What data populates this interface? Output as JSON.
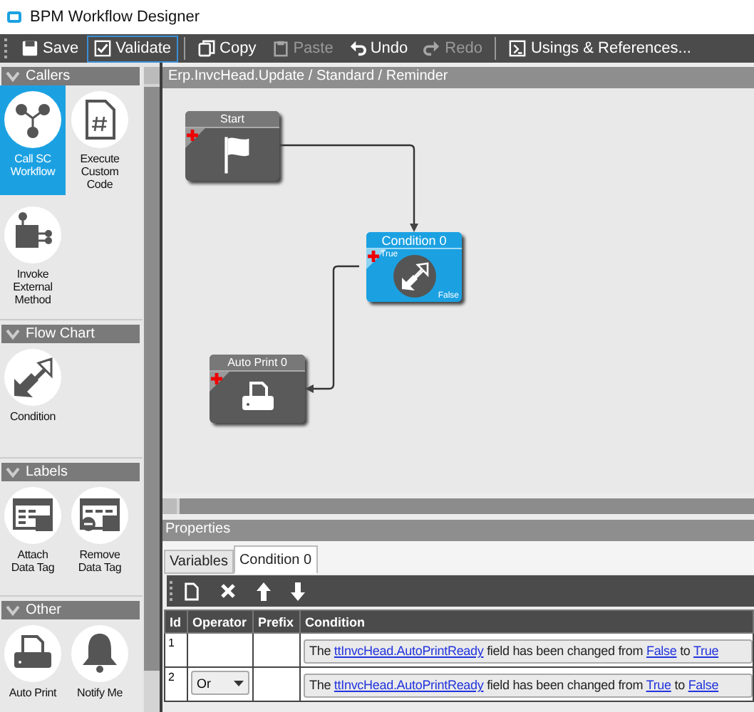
{
  "window": {
    "title": "BPM Workflow Designer"
  },
  "toolbar_groups": [
    [
      {
        "label": "Save",
        "kind": "save",
        "disabled": false,
        "focused": false
      },
      {
        "label": "Validate",
        "kind": "validate",
        "disabled": false,
        "focused": true
      }
    ],
    [
      {
        "label": "Copy",
        "kind": "copy",
        "disabled": false,
        "focused": false
      },
      {
        "label": "Paste",
        "kind": "paste",
        "disabled": true,
        "focused": false
      },
      {
        "label": "Undo",
        "kind": "undo",
        "disabled": false,
        "focused": false
      },
      {
        "label": "Redo",
        "kind": "redo",
        "disabled": true,
        "focused": false
      }
    ],
    [
      {
        "label": "Usings & References...",
        "kind": "usings",
        "disabled": false,
        "focused": false
      }
    ]
  ],
  "palette": {
    "sections": [
      {
        "title": "Callers",
        "expanded": true,
        "items": [
          {
            "label": "Call SC Workflow",
            "kind": "workflow",
            "selected": true
          },
          {
            "label": "Execute Custom Code",
            "kind": "code",
            "selected": false
          },
          {
            "label": "Invoke External Method",
            "kind": "method",
            "selected": false
          }
        ]
      },
      {
        "title": "Flow Chart",
        "expanded": true,
        "items": [
          {
            "label": "Condition",
            "kind": "condition",
            "selected": false
          }
        ]
      },
      {
        "title": "Labels",
        "expanded": true,
        "items": [
          {
            "label": "Attach Data Tag",
            "kind": "attach",
            "selected": false
          },
          {
            "label": "Remove Data Tag",
            "kind": "remove",
            "selected": false
          }
        ]
      },
      {
        "title": "Other",
        "expanded": true,
        "items": [
          {
            "label": "Auto Print",
            "kind": "print",
            "selected": false
          },
          {
            "label": "Notify Me",
            "kind": "bell",
            "selected": false
          }
        ]
      }
    ]
  },
  "canvas": {
    "path": "Erp.InvcHead.Update / Standard / Reminder",
    "nodes": [
      {
        "title": "Start",
        "kind": "start",
        "selected": false
      },
      {
        "title": "Condition 0",
        "kind": "condition",
        "selected": true,
        "true_label": "True",
        "false_label": "False"
      },
      {
        "title": "Auto Print 0",
        "kind": "print",
        "selected": false
      }
    ]
  },
  "properties": {
    "title": "Properties",
    "tabs": [
      {
        "label": "Variables",
        "selected": false
      },
      {
        "label": "Condition 0",
        "selected": true
      }
    ],
    "table": {
      "columns": [
        "Id",
        "Operator",
        "Prefix",
        "Condition"
      ],
      "rows": [
        {
          "id": "1",
          "condition": [
            {
              "text": "The "
            },
            {
              "text": "ttInvcHead.AutoPrintReady",
              "link": true
            },
            {
              "text": " field has been changed from "
            },
            {
              "text": "False",
              "link": true
            },
            {
              "text": " to "
            },
            {
              "text": "True",
              "link": true
            }
          ]
        },
        {
          "id": "2",
          "operator": "Or",
          "condition": [
            {
              "text": "The "
            },
            {
              "text": "ttInvcHead.AutoPrintReady",
              "link": true
            },
            {
              "text": " field has been changed from "
            },
            {
              "text": "True",
              "link": true
            },
            {
              "text": " to "
            },
            {
              "text": "False",
              "link": true
            }
          ]
        }
      ]
    }
  }
}
